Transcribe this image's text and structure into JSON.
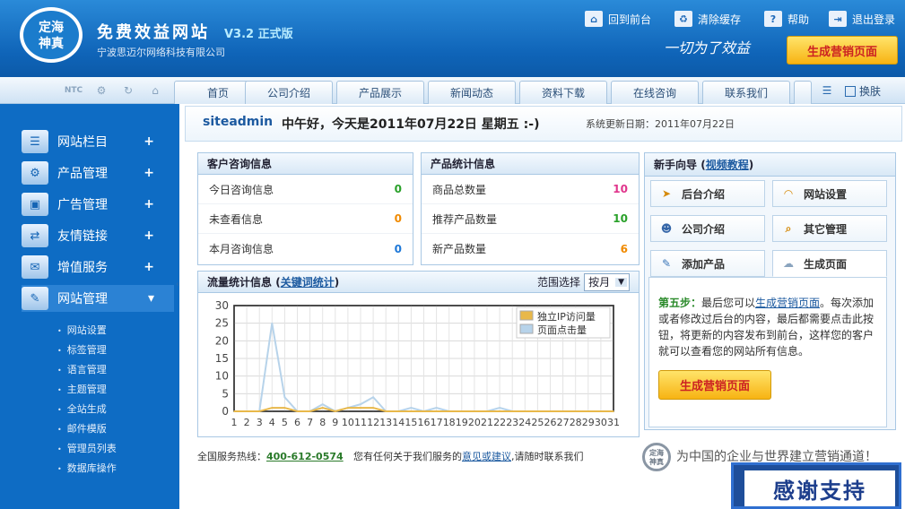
{
  "header": {
    "logo_text": "定海神真",
    "title": "免费效益网站",
    "version": "V3.2 正式版",
    "company": "宁波思迈尔网络科技有限公司",
    "links": [
      {
        "label": "回到前台",
        "icon": "home-icon"
      },
      {
        "label": "清除缓存",
        "icon": "trash-icon"
      },
      {
        "label": "帮助",
        "icon": "help-icon"
      },
      {
        "label": "退出登录",
        "icon": "logout-icon"
      }
    ],
    "slogan": "一切为了效益",
    "generate_btn": "生成营销页面"
  },
  "nav": {
    "tabs": [
      "首页",
      "公司介绍",
      "产品展示",
      "新闻动态",
      "资料下载",
      "在线咨询",
      "联系我们"
    ],
    "skin_label": "换肤"
  },
  "sidebar": {
    "menus": [
      {
        "label": "网站栏目",
        "icon": "columns-icon",
        "toggle": "+"
      },
      {
        "label": "产品管理",
        "icon": "gear-icon",
        "toggle": "+"
      },
      {
        "label": "广告管理",
        "icon": "monitor-icon",
        "toggle": "+"
      },
      {
        "label": "友情链接",
        "icon": "link-icon",
        "toggle": "+"
      },
      {
        "label": "增值服务",
        "icon": "chat-icon",
        "toggle": "+"
      },
      {
        "label": "网站管理",
        "icon": "tools-icon",
        "toggle": "▾"
      }
    ],
    "submenu": [
      "网站设置",
      "标签管理",
      "语言管理",
      "主题管理",
      "全站生成",
      "邮件模版",
      "管理员列表",
      "数据库操作"
    ]
  },
  "greeting": {
    "user": "siteadmin",
    "message": "中午好，今天是2011年07月22日  星期五  :-)",
    "update_label": "系统更新日期：2011年07月22日"
  },
  "consult": {
    "title": "客户咨询信息",
    "rows": [
      {
        "label": "今日咨询信息",
        "value": "0",
        "color": "#2aa12a"
      },
      {
        "label": "未查看信息",
        "value": "0",
        "color": "#f08a00"
      },
      {
        "label": "本月咨询信息",
        "value": "0",
        "color": "#1e78d8"
      }
    ]
  },
  "products": {
    "title": "产品统计信息",
    "rows": [
      {
        "label": "商品总数量",
        "value": "10",
        "color": "#e0358c"
      },
      {
        "label": "推荐产品数量",
        "value": "10",
        "color": "#2aa12a"
      },
      {
        "label": "新产品数量",
        "value": "6",
        "color": "#f08a00"
      }
    ]
  },
  "traffic": {
    "title": "流量统计信息",
    "keyword_link": "关键词统计",
    "range_label": "范围选择",
    "range_value": "按月"
  },
  "chart_data": {
    "type": "line",
    "x": [
      1,
      2,
      3,
      4,
      5,
      6,
      7,
      8,
      9,
      10,
      11,
      12,
      13,
      14,
      15,
      16,
      17,
      18,
      19,
      20,
      21,
      22,
      23,
      24,
      25,
      26,
      27,
      28,
      29,
      30,
      31
    ],
    "ylim": [
      0,
      30
    ],
    "yticks": [
      0,
      5,
      10,
      15,
      20,
      25,
      30
    ],
    "grid": true,
    "legend": "top-right",
    "series": [
      {
        "name": "独立IP访问量",
        "color": "#e8b84a",
        "values": [
          0,
          0,
          0,
          1,
          1,
          0,
          0,
          1,
          0,
          1,
          1,
          1,
          0,
          0,
          0,
          0,
          0,
          0,
          0,
          0,
          0,
          0,
          0,
          0,
          0,
          0,
          0,
          0,
          0,
          0,
          0
        ]
      },
      {
        "name": "页面点击量",
        "color": "#b7d3ea",
        "values": [
          0,
          0,
          0,
          25,
          4,
          0,
          0,
          2,
          0,
          1,
          2,
          4,
          0,
          0,
          1,
          0,
          1,
          0,
          0,
          0,
          0,
          1,
          0,
          0,
          0,
          0,
          0,
          0,
          0,
          0,
          0
        ]
      }
    ]
  },
  "guide": {
    "title": "新手向导",
    "video_link": "视频教程",
    "buttons": [
      {
        "label": "后台介绍",
        "icon": "cursor-icon"
      },
      {
        "label": "网站设置",
        "icon": "rainbow-icon"
      },
      {
        "label": "公司介绍",
        "icon": "user-icon"
      },
      {
        "label": "其它管理",
        "icon": "magnifier-icon"
      },
      {
        "label": "添加产品",
        "icon": "pencil-icon"
      },
      {
        "label": "生成页面",
        "icon": "cloud-icon"
      }
    ],
    "step_label": "第五步：",
    "step_text_1": "最后您可以",
    "step_link": "生成营销页面",
    "step_text_2": "。每次添加或者修改过后台的内容，最后都需要点击此按钮，将更新的内容发布到前台，这样您的客户就可以查看您的网站所有信息。",
    "generate_btn": "生成营销页面"
  },
  "footer": {
    "hotline_label": "全国服务热线：",
    "hotline": "400-612-0574",
    "feedback_pre": "您有任何关于我们服务的",
    "feedback_link": "意见或建议",
    "feedback_post": ",请随时联系我们",
    "slogan": "为中国的企业与世界建立营销通道！",
    "stamp": "感谢支持"
  }
}
